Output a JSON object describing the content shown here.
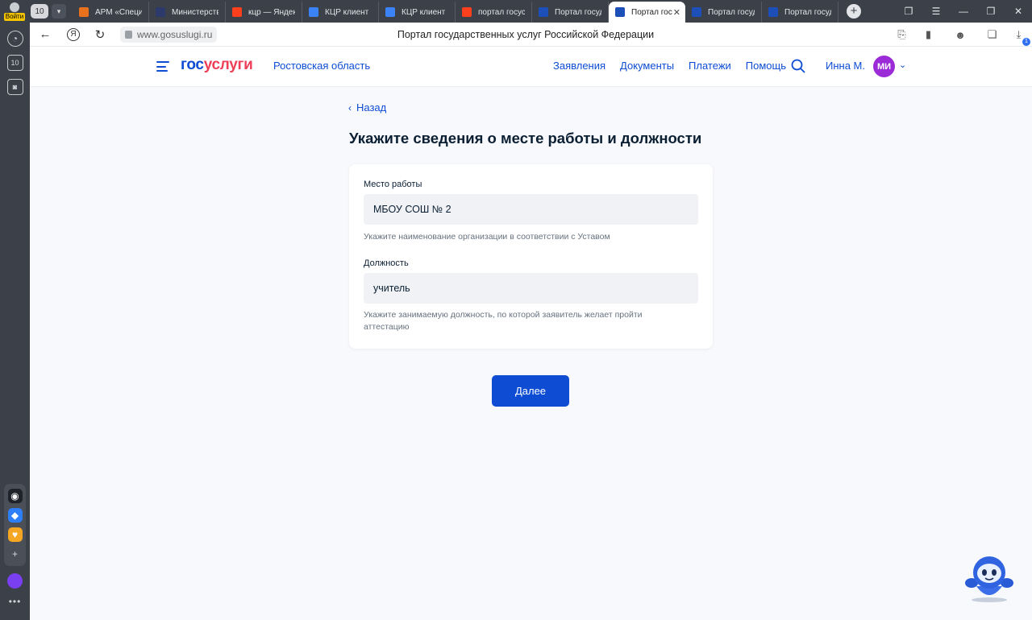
{
  "browser": {
    "login_label": "Войти",
    "tab_count": "10",
    "tabs": [
      {
        "title": "АРМ «Специ",
        "color": "#e8711e"
      },
      {
        "title": "Министерств",
        "color": "#2b3a6b"
      },
      {
        "title": "кцр — Яндекс",
        "color": "#fc3f1d"
      },
      {
        "title": "КЦР клиент",
        "color": "#3b82f6"
      },
      {
        "title": "КЦР клиент",
        "color": "#3b82f6"
      },
      {
        "title": "портал госус",
        "color": "#fc3f1d"
      },
      {
        "title": "Портал госуд",
        "color": "#1c4fb8"
      },
      {
        "title": "Портал гос",
        "color": "#1c4fb8",
        "active": true
      },
      {
        "title": "Портал госуд",
        "color": "#1c4fb8"
      },
      {
        "title": "Портал госуд",
        "color": "#1c4fb8"
      }
    ],
    "url": "www.gosuslugi.ru",
    "page_title": "Портал государственных услуг Российской Федерации",
    "download_count": "1"
  },
  "site": {
    "logo_part1": "гос",
    "logo_part2": "услуги",
    "region": "Ростовская область",
    "nav": [
      "Заявления",
      "Документы",
      "Платежи",
      "Помощь"
    ],
    "user_name": "Инна М.",
    "user_initials": "МИ"
  },
  "form": {
    "back_label": "Назад",
    "title": "Укажите сведения о месте работы и должности",
    "workplace": {
      "label": "Место работы",
      "value": "МБОУ СОШ № 2",
      "hint": "Укажите наименование организации в соответствии с Уставом"
    },
    "position": {
      "label": "Должность",
      "value": "учитель",
      "hint": "Укажите занимаемую должность, по которой заявитель желает пройти аттестацию"
    },
    "next_label": "Далее"
  },
  "colors": {
    "brand_blue": "#0d4cd3",
    "brand_red": "#ee3f58",
    "avatar": "#9b2bd6"
  }
}
